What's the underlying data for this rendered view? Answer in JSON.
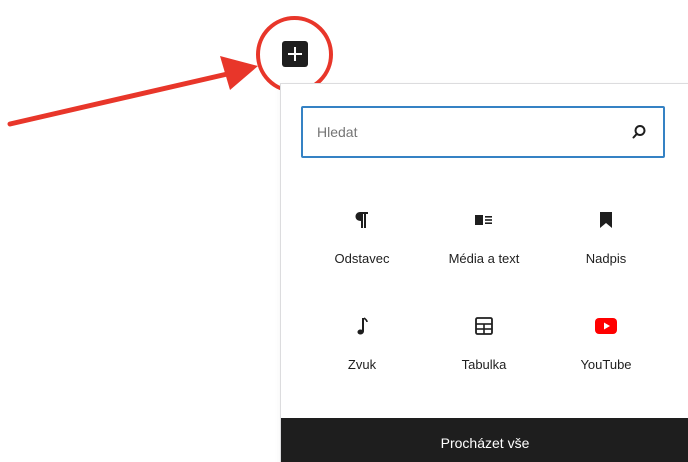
{
  "toolbar": {
    "add_block_icon": "plus-icon"
  },
  "annotation": {
    "color": "#e8362a"
  },
  "inserter": {
    "search": {
      "placeholder": "Hledat",
      "value": "",
      "icon": "search-icon"
    },
    "blocks": [
      {
        "label": "Odstavec",
        "icon": "paragraph-icon"
      },
      {
        "label": "Média a text",
        "icon": "media-text-icon"
      },
      {
        "label": "Nadpis",
        "icon": "bookmark-heading-icon"
      },
      {
        "label": "Zvuk",
        "icon": "audio-icon"
      },
      {
        "label": "Tabulka",
        "icon": "table-icon"
      },
      {
        "label": "YouTube",
        "icon": "youtube-icon"
      }
    ],
    "browse_all_label": "Procházet vše"
  },
  "colors": {
    "dark": "#1e1e1e",
    "focus_blue": "#3582c4",
    "youtube_red": "#ff0000"
  }
}
